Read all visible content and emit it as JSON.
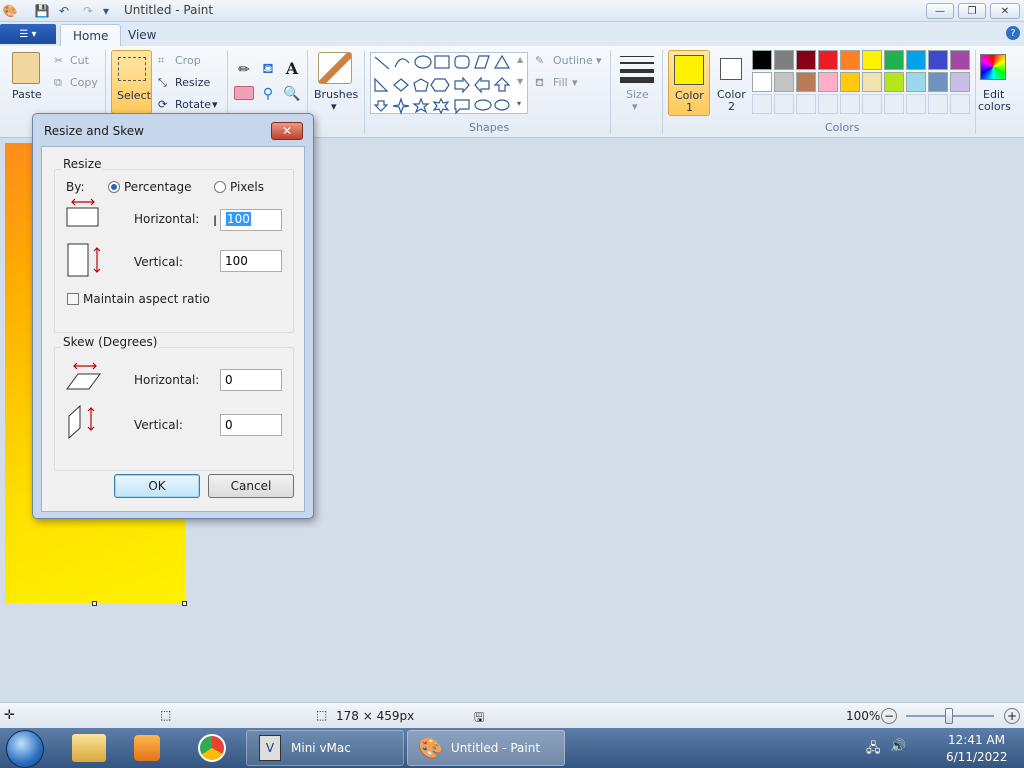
{
  "window": {
    "title": "Untitled - Paint"
  },
  "tabs": {
    "home": "Home",
    "view": "View"
  },
  "ribbon": {
    "clipboard": {
      "paste": "Paste",
      "cut": "Cut",
      "copy": "Copy"
    },
    "image": {
      "select": "Select",
      "crop": "Crop",
      "resize": "Resize",
      "rotate": "Rotate"
    },
    "brushes": "Brushes",
    "shapes": {
      "outline": "Outline",
      "fill": "Fill",
      "group": "Shapes"
    },
    "size": "Size",
    "color1": {
      "line1": "Color",
      "line2": "1"
    },
    "color2": {
      "line1": "Color",
      "line2": "2"
    },
    "colors_group": "Colors",
    "edit_colors": {
      "line1": "Edit",
      "line2": "colors"
    },
    "palette_row1": [
      "#000000",
      "#7f7f7f",
      "#880015",
      "#ed1c24",
      "#ff7f27",
      "#fff200",
      "#22b14c",
      "#00a2e8",
      "#3f48cc",
      "#a349a4"
    ],
    "palette_row2": [
      "#ffffff",
      "#c3c3c3",
      "#b97a57",
      "#ffaec9",
      "#ffc90e",
      "#efe4b0",
      "#b5e61d",
      "#99d9ea",
      "#7092be",
      "#c8bfe7"
    ],
    "color1_value": "#fff200",
    "color2_value": "#ffffff"
  },
  "dialog": {
    "title": "Resize and Skew",
    "resize_legend": "Resize",
    "by_label": "By:",
    "percentage": "Percentage",
    "pixels": "Pixels",
    "horizontal_label": "Horizontal:",
    "vertical_label": "Vertical:",
    "resize_horizontal": "100",
    "resize_vertical": "100",
    "maintain_aspect": "Maintain aspect ratio",
    "skew_legend": "Skew (Degrees)",
    "skew_horizontal": "0",
    "skew_vertical": "0",
    "ok": "OK",
    "cancel": "Cancel"
  },
  "status": {
    "dimensions": "178 × 459px",
    "zoom": "100%"
  },
  "taskbar": {
    "minivmac": "Mini vMac",
    "paint": "Untitled - Paint",
    "time": "12:41 AM",
    "date": "6/11/2022"
  }
}
